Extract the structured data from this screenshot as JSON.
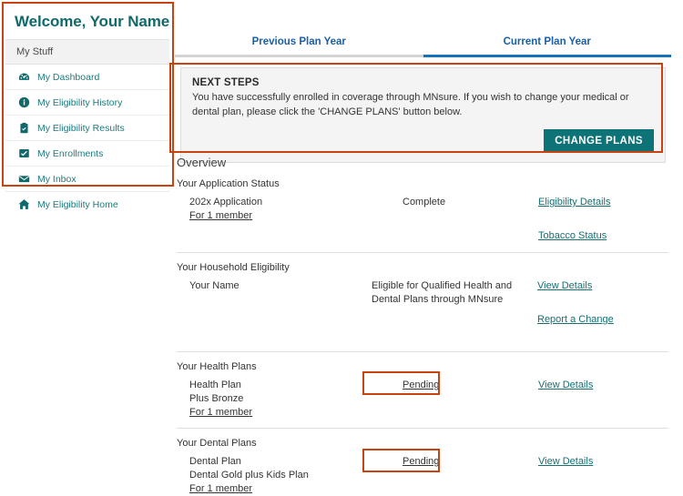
{
  "sidebar": {
    "welcome_heading": "Welcome, Your Name",
    "section_header": "My Stuff",
    "items": [
      {
        "label": "My Dashboard",
        "icon": "dashboard-icon"
      },
      {
        "label": "My Eligibility History",
        "icon": "info-circle-icon"
      },
      {
        "label": "My Eligibility Results",
        "icon": "clipboard-icon"
      },
      {
        "label": "My Enrollments",
        "icon": "check-square-icon"
      },
      {
        "label": "My Inbox",
        "icon": "envelope-icon"
      },
      {
        "label": "My Eligibility Home",
        "icon": "home-icon"
      }
    ]
  },
  "tabs": [
    {
      "label": "Previous Plan Year",
      "active": false
    },
    {
      "label": "Current Plan Year",
      "active": true
    }
  ],
  "next_steps": {
    "title": "NEXT STEPS",
    "body": "You have successfully enrolled in coverage through MNsure. If you wish to change your medical or dental plan, please click the  'CHANGE PLANS' button below.",
    "button_label": "CHANGE PLANS"
  },
  "overview": {
    "title": "Overview",
    "sections": [
      {
        "heading": "Your Application Status",
        "name_lines": [
          "202x Application"
        ],
        "name_link": "For 1 member",
        "status": "Complete",
        "links": [
          "Eligibility Details",
          "Tobacco Status"
        ]
      },
      {
        "heading": "Your Household Eligibility",
        "name_lines": [
          "Your Name"
        ],
        "name_link": "",
        "status": "Eligible for Qualified Health and Dental Plans through MNsure",
        "links": [
          "View Details",
          "Report a Change"
        ]
      },
      {
        "heading": "Your Health Plans",
        "name_lines": [
          "Health Plan",
          "Plus Bronze"
        ],
        "name_link": "For 1 member",
        "status": "Pending",
        "links": [
          "View Details"
        ]
      },
      {
        "heading": "Your  Dental Plans",
        "name_lines": [
          "Dental Plan",
          "Dental Gold plus Kids Plan"
        ],
        "name_link": "For 1 member",
        "status": "Pending",
        "links": [
          "View Details"
        ]
      }
    ]
  },
  "colors": {
    "annotation": "#c8430f",
    "teal": "#0d7377",
    "heading_teal": "#10696b",
    "tab_blue": "#1573bd",
    "link_teal": "#176f72"
  }
}
